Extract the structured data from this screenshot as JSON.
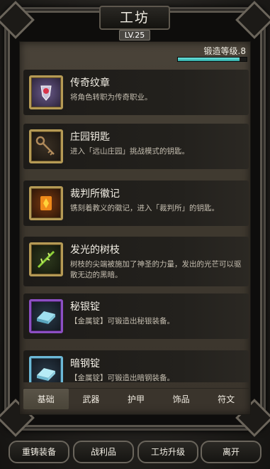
{
  "window": {
    "title": "工坊",
    "level_badge": "LV.25"
  },
  "forge": {
    "level_text": "锻造等级.8",
    "progress": 0.9
  },
  "items": [
    {
      "name": "传奇纹章",
      "desc": "将角色转职为传奇职业。",
      "icon": "legend-crest-icon",
      "rarity": "gold"
    },
    {
      "name": "庄园钥匙",
      "desc": "进入「远山庄园」挑战模式的钥匙。",
      "icon": "key-icon",
      "rarity": "gold"
    },
    {
      "name": "裁判所徽记",
      "desc": "镌刻着教义的徽记，进入「裁判所」的钥匙。",
      "icon": "inquisition-emblem-icon",
      "rarity": "gold"
    },
    {
      "name": "发光的树枝",
      "desc": "树枝的尖端被施加了神圣的力量，发出的光芒可以驱散无边的黑暗。",
      "icon": "glowing-branch-icon",
      "rarity": "gold"
    },
    {
      "name": "秘银锭",
      "desc": "【金属锭】可锻造出秘银装备。",
      "icon": "mithril-ingot-icon",
      "rarity": "purple"
    },
    {
      "name": "暗钢锭",
      "desc": "【金属锭】可锻造出暗钢装备。",
      "icon": "dark-steel-ingot-icon",
      "rarity": "cyan"
    }
  ],
  "tabs": [
    {
      "label": "基础",
      "active": true
    },
    {
      "label": "武器",
      "active": false
    },
    {
      "label": "护甲",
      "active": false
    },
    {
      "label": "饰品",
      "active": false
    },
    {
      "label": "符文",
      "active": false
    }
  ],
  "bottom_buttons": [
    {
      "label": "重铸装备"
    },
    {
      "label": "战利品"
    },
    {
      "label": "工坊升级"
    },
    {
      "label": "离开"
    }
  ],
  "colors": {
    "progress_fill": "#4fd0cb",
    "gold_frame": "#b59a55",
    "purple_frame": "#8c4fc3",
    "cyan_frame": "#6cb8d6"
  }
}
